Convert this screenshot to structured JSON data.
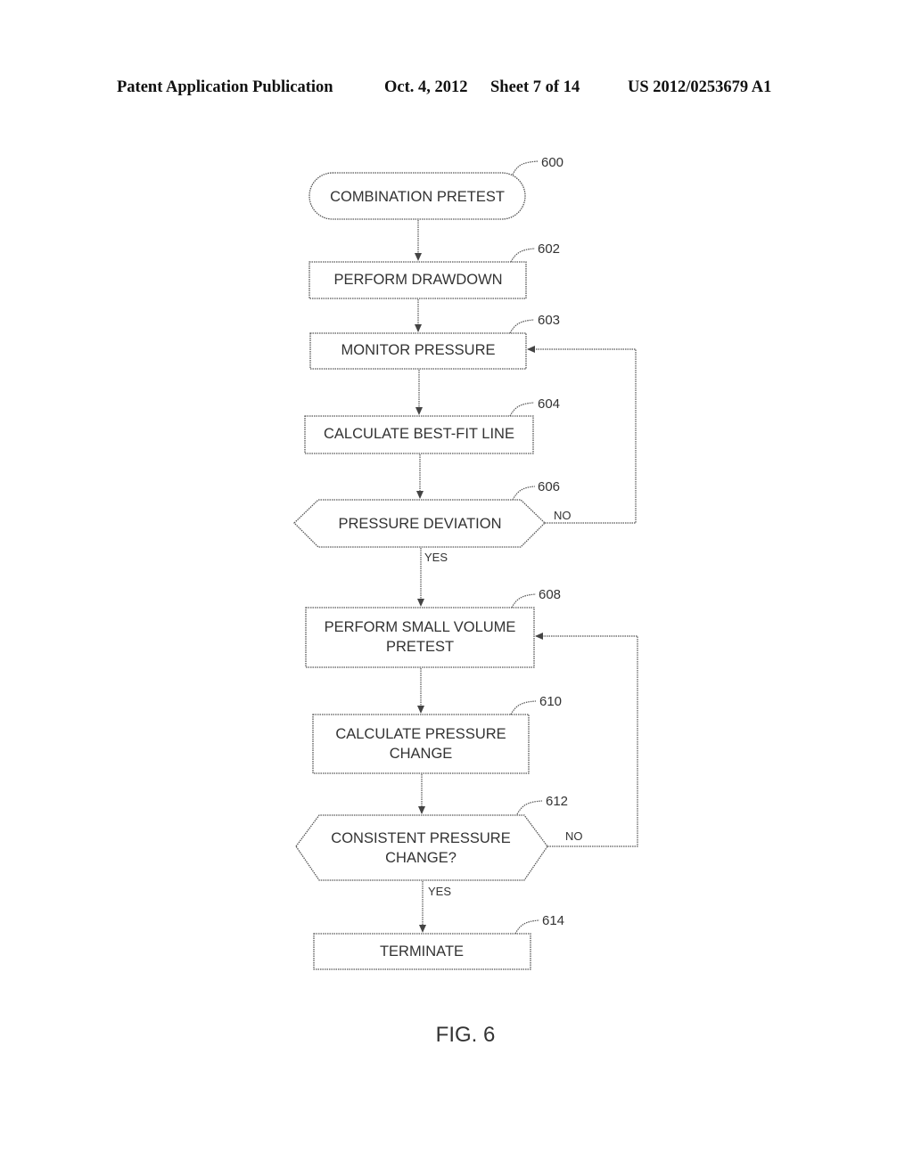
{
  "header": {
    "publication": "Patent Application Publication",
    "date": "Oct. 4, 2012",
    "sheet": "Sheet 7 of 14",
    "number": "US 2012/0253679 A1"
  },
  "figure_label": "FIG. 6",
  "nodes": [
    {
      "id": "600",
      "type": "terminal",
      "lines": [
        "COMBINATION PRETEST"
      ]
    },
    {
      "id": "602",
      "type": "process",
      "lines": [
        "PERFORM DRAWDOWN"
      ]
    },
    {
      "id": "603",
      "type": "process",
      "lines": [
        "MONITOR PRESSURE"
      ]
    },
    {
      "id": "604",
      "type": "process",
      "lines": [
        "CALCULATE BEST-FIT LINE"
      ]
    },
    {
      "id": "606",
      "type": "decision",
      "lines": [
        "PRESSURE DEVIATION"
      ]
    },
    {
      "id": "608",
      "type": "process",
      "lines": [
        "PERFORM SMALL VOLUME",
        "PRETEST"
      ]
    },
    {
      "id": "610",
      "type": "process",
      "lines": [
        "CALCULATE PRESSURE",
        "CHANGE"
      ]
    },
    {
      "id": "612",
      "type": "decision",
      "lines": [
        "CONSISTENT PRESSURE",
        "CHANGE?"
      ]
    },
    {
      "id": "614",
      "type": "process",
      "lines": [
        "TERMINATE"
      ]
    }
  ],
  "edges": [
    {
      "from": "600",
      "to": "602",
      "label": ""
    },
    {
      "from": "602",
      "to": "603",
      "label": ""
    },
    {
      "from": "603",
      "to": "604",
      "label": ""
    },
    {
      "from": "604",
      "to": "606",
      "label": ""
    },
    {
      "from": "606",
      "to": "608",
      "label": "YES"
    },
    {
      "from": "606",
      "to": "603",
      "label": "NO"
    },
    {
      "from": "608",
      "to": "610",
      "label": ""
    },
    {
      "from": "610",
      "to": "612",
      "label": ""
    },
    {
      "from": "612",
      "to": "614",
      "label": "YES"
    },
    {
      "from": "612",
      "to": "608",
      "label": "NO"
    }
  ]
}
